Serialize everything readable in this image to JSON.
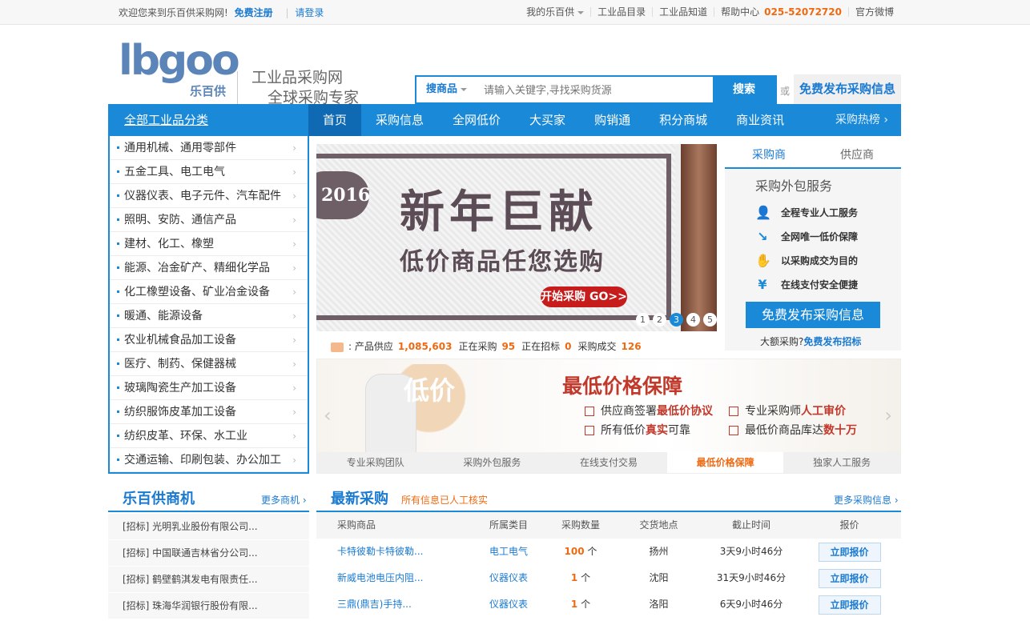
{
  "topbar": {
    "welcome": "欢迎您来到乐百供采购网!",
    "register": "免费注册",
    "login": "请登录",
    "my": "我的乐百供",
    "catalog": "工业品目录",
    "knowledge": "工业品知道",
    "help": "帮助中心",
    "phone": "025-52072720",
    "weibo": "官方微博"
  },
  "header": {
    "logo_text": "lbgoo",
    "logo_sub": "乐百供",
    "slogan1": "工业品采购网",
    "slogan2": "全球采购专家",
    "search_cat": "搜商品",
    "search_placeholder": "请输入关键字,寻找采购货源",
    "search_btn": "搜索",
    "or": "或",
    "publish": "免费发布采购信息"
  },
  "nav": {
    "all": "全部工业品分类",
    "items": [
      "首页",
      "采购信息",
      "全网低价",
      "大买家",
      "购销通",
      "积分商城",
      "商业资讯"
    ],
    "hot": "采购热榜 ›"
  },
  "categories": [
    "通用机械、通用零部件",
    "五金工具、电工电气",
    "仪器仪表、电子元件、汽车配件",
    "照明、安防、通信产品",
    "建材、化工、橡塑",
    "能源、冶金矿产、精细化学品",
    "化工橡塑设备、矿业冶金设备",
    "暖通、能源设备",
    "农业机械食品加工设备",
    "医疗、制药、保健器械",
    "玻璃陶瓷生产加工设备",
    "纺织服饰皮革加工设备",
    "纺织皮革、环保、水工业",
    "交通运输、印刷包装、办公加工"
  ],
  "banner": {
    "year": "2016",
    "title": "新年巨献",
    "subtitle": "低价商品任您选购",
    "go": "开始采购 GO>>",
    "pages": [
      "1",
      "2",
      "3",
      "4",
      "5"
    ],
    "active_page": "3"
  },
  "stats": {
    "supply_label": ": 产品供应",
    "supply": "1,085,603",
    "buying_label": "正在采购",
    "buying": "95",
    "tender_label": "正在招标",
    "tender": "0",
    "deals_label": "采购成交",
    "deals": "126"
  },
  "right_panel": {
    "tab_buyer": "采购商",
    "tab_supplier": "供应商",
    "title": "采购外包服务",
    "features": [
      "全程专业人工服务",
      "全网唯一低价保障",
      "以采购成交为目的",
      "在线支付安全便捷"
    ],
    "publish_btn": "免费发布采购信息",
    "big_label": "大额采购?",
    "big_link": "免费发布招标"
  },
  "promo": {
    "dijia": "低价",
    "title": "最低价格保障",
    "items": [
      {
        "a": "供应商签署",
        "b": "最低价协议",
        "c": ""
      },
      {
        "a": "专业采购师",
        "b": "人工审价",
        "c": ""
      },
      {
        "a": "所有低价",
        "b": "真实",
        "c": "可靠"
      },
      {
        "a": "最低价商品库达",
        "b": "数十万",
        "c": ""
      }
    ],
    "tabs": [
      "专业采购团队",
      "采购外包服务",
      "在线支付交易",
      "最低价格保障",
      "独家人工服务"
    ],
    "active_tab": "最低价格保障"
  },
  "opportunities": {
    "title": "乐百供商机",
    "more": "更多商机 ›",
    "rows": [
      "[招标] 光明乳业股份有限公司...",
      "[招标] 中国联通吉林省分公司...",
      "[招标] 鹤壁鹤淇发电有限责任...",
      "[招标] 珠海华润银行股份有限..."
    ]
  },
  "latest": {
    "title": "最新采购",
    "note": "所有信息已人工核实",
    "more": "更多采购信息 ›",
    "headers": [
      "采购商品",
      "所属类目",
      "采购数量",
      "交货地点",
      "截止时间",
      "报价"
    ],
    "rows": [
      {
        "product": "卡特彼勒卡特彼勒...",
        "category": "电工电气",
        "qty": "100",
        "unit": "个",
        "place": "扬州",
        "deadline": "3天9小时46分",
        "action": "立即报价"
      },
      {
        "product": "新威电池电压内阻...",
        "category": "仪器仪表",
        "qty": "1",
        "unit": "个",
        "place": "沈阳",
        "deadline": "31天9小时46分",
        "action": "立即报价"
      },
      {
        "product": "三鼎(鼎吉)手持...",
        "category": "仪器仪表",
        "qty": "1",
        "unit": "个",
        "place": "洛阳",
        "deadline": "6天9小时46分",
        "action": "立即报价"
      }
    ]
  }
}
